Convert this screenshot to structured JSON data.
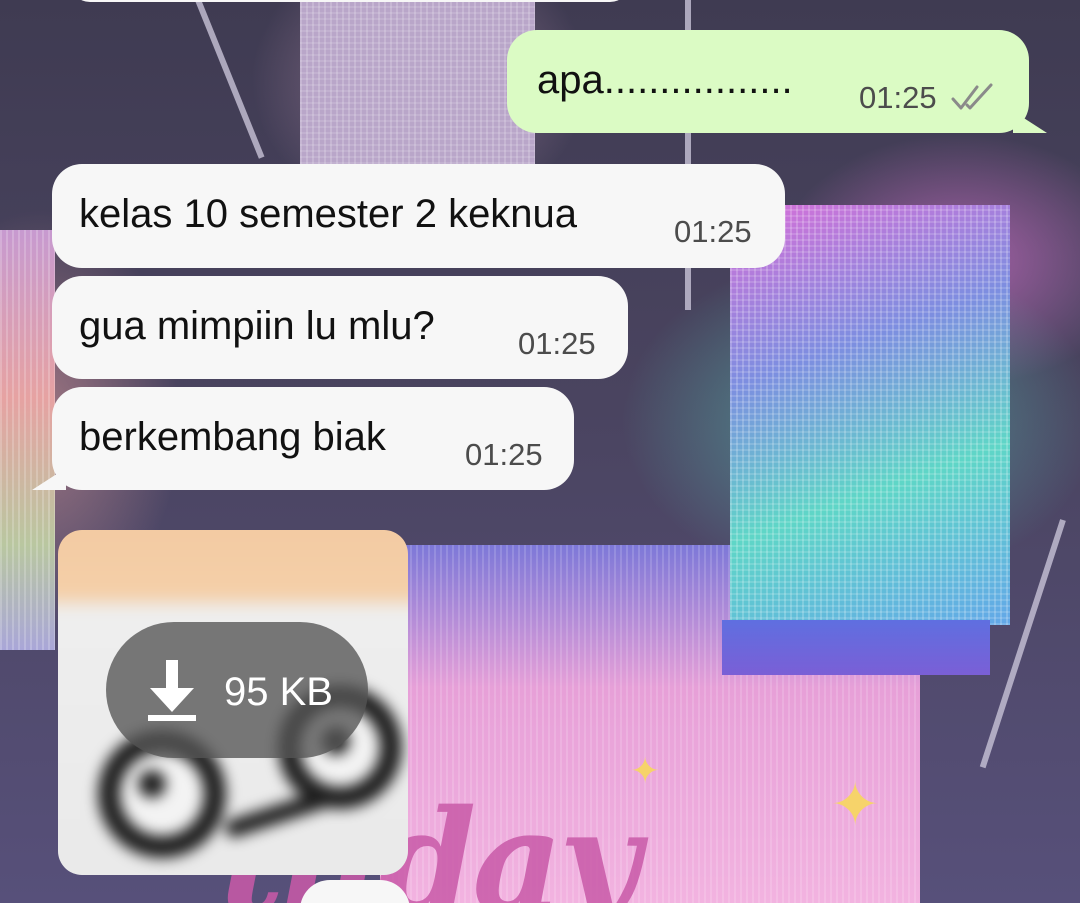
{
  "messages": [
    {
      "id": "m1",
      "direction": "outgoing",
      "text": "apa.................",
      "time": "01:25",
      "status_icon": "double-check-icon"
    },
    {
      "id": "m2",
      "direction": "incoming",
      "text": "kelas 10 semester 2 keknua",
      "time": "01:25"
    },
    {
      "id": "m3",
      "direction": "incoming",
      "text": "gua mimpiin lu mlu?",
      "time": "01:25"
    },
    {
      "id": "m4",
      "direction": "incoming",
      "text": "berkembang biak",
      "time": "01:25"
    }
  ],
  "image_message": {
    "direction": "incoming",
    "download_size": "95 KB",
    "download_icon": "download-arrow-icon"
  },
  "colors": {
    "outgoing_bubble": "#dbfbc4",
    "incoming_bubble": "#f7f7f7",
    "timestamp": "#4c4c4c",
    "download_pill": "#555555"
  }
}
